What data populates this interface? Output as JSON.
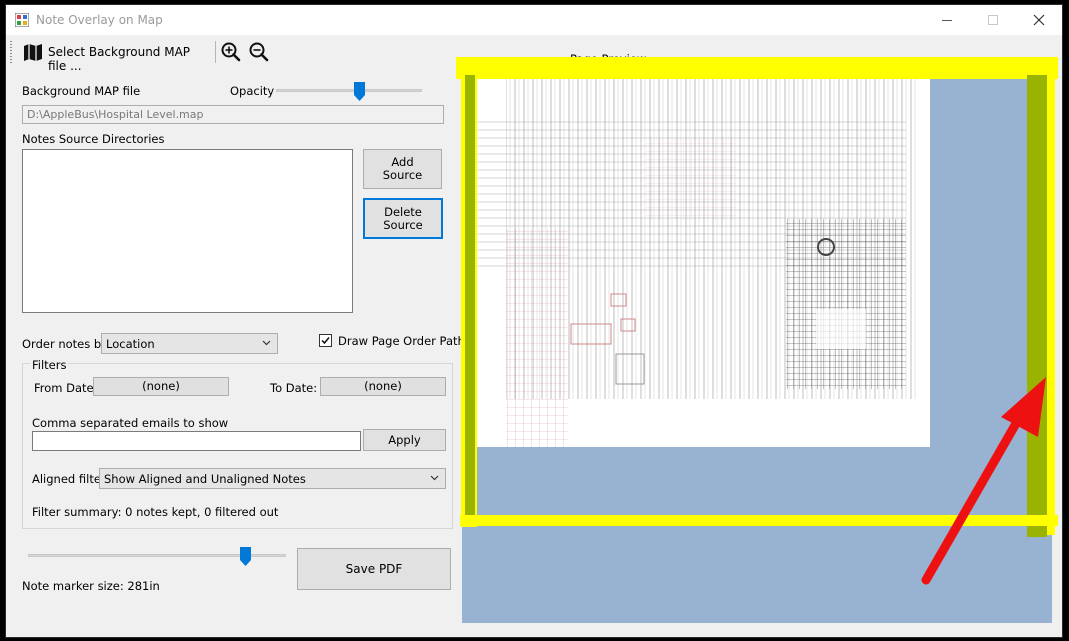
{
  "window": {
    "title": "Note Overlay on Map",
    "controls": [
      "minimize-icon",
      "maximize-icon",
      "close-icon"
    ]
  },
  "toolbar": {
    "select_map_label": "Select Background MAP file ...",
    "icons": [
      "map-icon",
      "zoom-in-icon",
      "zoom-out-icon"
    ]
  },
  "background": {
    "label": "Background MAP file",
    "opacity_label": "Opacity",
    "opacity_value": 0.58,
    "file_path": "D:\\AppleBus\\Hospital Level.map"
  },
  "sources": {
    "label": "Notes Source Directories",
    "items": [],
    "add_button": "Add\nSource",
    "delete_button": "Delete\nSource"
  },
  "order": {
    "label": "Order notes by",
    "selected": "Location",
    "draw_path_label": "Draw Page Order Path",
    "draw_path_checked": true
  },
  "filters": {
    "group_label": "Filters",
    "from_date_label": "From Date:",
    "from_date_value": "(none)",
    "to_date_label": "To Date:",
    "to_date_value": "(none)",
    "emails_label": "Comma separated emails to show",
    "emails_value": "",
    "apply_button": "Apply",
    "aligned_label": "Aligned filter:",
    "aligned_selected": "Show Aligned and Unaligned Notes",
    "summary": "Filter summary: 0 notes kept, 0 filtered out"
  },
  "marker": {
    "size_label": "Note marker size: 281in",
    "slider_value": 0.86
  },
  "save_button": "Save PDF",
  "preview": {
    "label": "Page Preview"
  },
  "colors": {
    "preview_bg": "#98b3d2",
    "highlight_yellow": "#ffff00",
    "highlight_green": "#99b300",
    "arrow_red": "#ee1111",
    "focus_blue": "#0078d7"
  }
}
